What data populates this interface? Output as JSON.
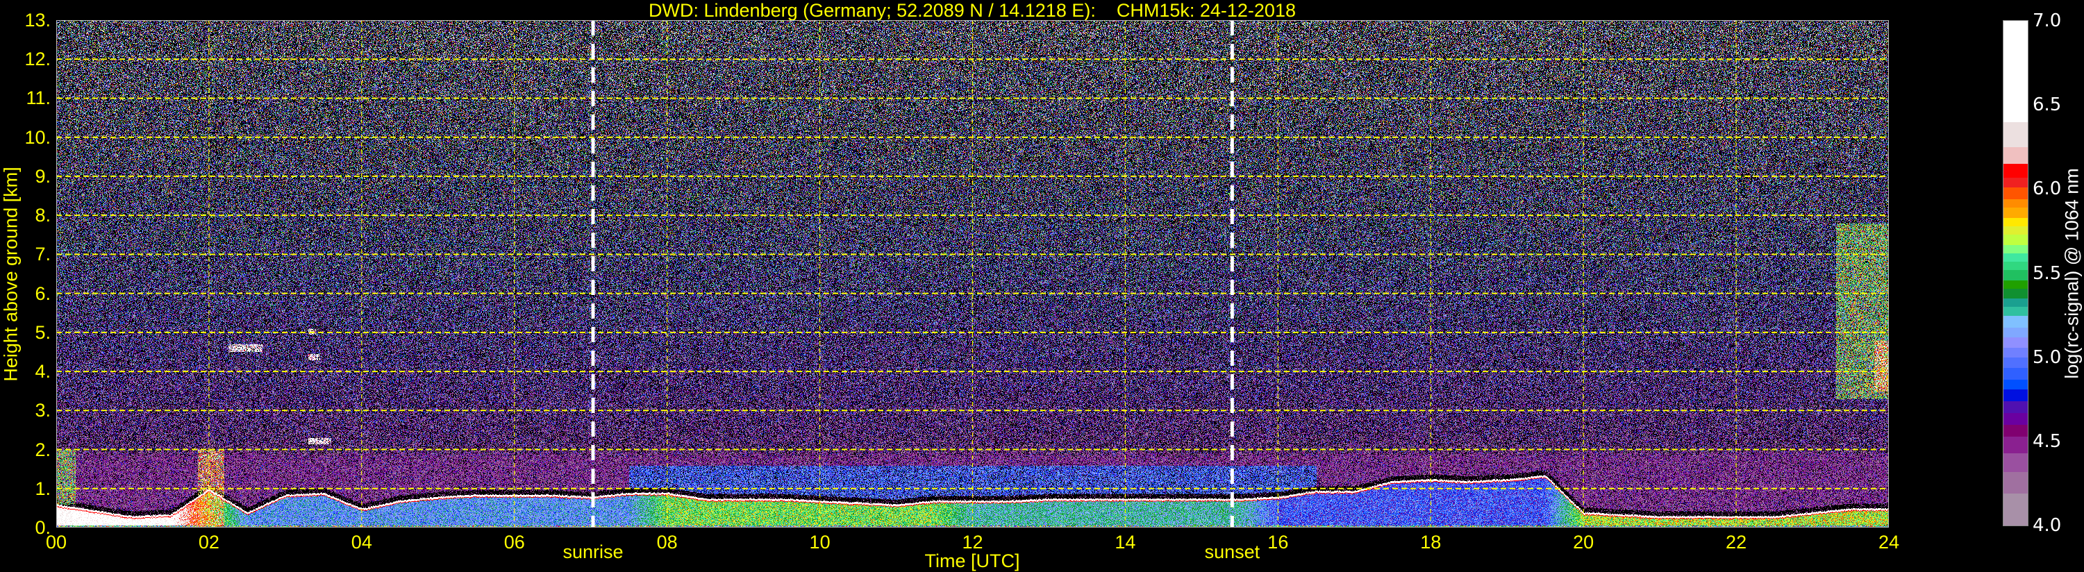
{
  "chart_data": {
    "type": "heatmap",
    "title": "DWD: Lindenberg (Germany; 52.2089 N / 14.1218 E):    CHM15k: 24-12-2018",
    "xlabel": "Time [UTC]",
    "ylabel": "Height above ground [km]",
    "xlim": [
      0,
      24
    ],
    "ylim": [
      0,
      13
    ],
    "xticks": [
      0,
      2,
      4,
      6,
      8,
      10,
      12,
      14,
      16,
      18,
      20,
      22,
      24
    ],
    "xtick_labels": [
      "00",
      "02",
      "04",
      "06",
      "08",
      "10",
      "12",
      "14",
      "16",
      "18",
      "20",
      "22",
      "24"
    ],
    "yticks": [
      0,
      1,
      2,
      3,
      4,
      5,
      6,
      7,
      8,
      9,
      10,
      11,
      12,
      13
    ],
    "ytick_labels": [
      "0.",
      "1.",
      "2.",
      "3.",
      "4.",
      "5.",
      "6.",
      "7.",
      "8.",
      "9.",
      "10.",
      "11.",
      "12.",
      "13."
    ],
    "grid": true,
    "events": [
      {
        "label": "sunrise",
        "time": 7.03
      },
      {
        "label": "sunset",
        "time": 15.4
      }
    ],
    "colorbar": {
      "label": "log(rc-signal) @ 1064 nm",
      "range": [
        4.0,
        7.0
      ],
      "ticks": [
        4.0,
        4.5,
        5.0,
        5.5,
        6.0,
        6.5,
        7.0
      ],
      "tick_labels": [
        "4.0",
        "4.5",
        "5.0",
        "5.5",
        "6.0",
        "6.5",
        "7.0"
      ],
      "boundaries": [
        4.0,
        4.19,
        4.32,
        4.43,
        4.53,
        4.6,
        4.67,
        4.74,
        4.81,
        4.87,
        4.94,
        5.0,
        5.06,
        5.12,
        5.18,
        5.25,
        5.3,
        5.35,
        5.41,
        5.46,
        5.52,
        5.57,
        5.62,
        5.67,
        5.73,
        5.78,
        5.83,
        5.89,
        5.94,
        6.01,
        6.07,
        6.15,
        6.25,
        6.4,
        7.0
      ],
      "colors": [
        "#a890a8",
        "#a070a0",
        "#9a50a0",
        "#8a2090",
        "#800070",
        "#6a00a0",
        "#5010b0",
        "#0010e0",
        "#0050ff",
        "#3060ff",
        "#5070ff",
        "#7080ff",
        "#9090ff",
        "#80a8ff",
        "#80c0ff",
        "#30c0a0",
        "#1aa090",
        "#109030",
        "#20a000",
        "#20c060",
        "#30d880",
        "#40e8a0",
        "#80ff80",
        "#c0ff40",
        "#e0f030",
        "#ffe800",
        "#ffaa00",
        "#ff8c00",
        "#ff5500",
        "#f02020",
        "#ff0000",
        "#f0c0c0",
        "#ece0e0",
        "#ffffff"
      ]
    },
    "series_time_h": [
      0,
      0.5,
      1,
      1.5,
      2,
      2.5,
      3,
      3.5,
      4,
      4.5,
      5,
      5.5,
      6,
      6.5,
      7,
      7.5,
      8,
      8.5,
      9,
      9.5,
      10,
      10.5,
      11,
      11.5,
      12,
      12.5,
      13,
      13.5,
      14,
      14.5,
      15,
      15.5,
      16,
      16.5,
      17,
      17.5,
      18,
      18.5,
      19,
      19.5,
      20,
      20.5,
      21,
      21.5,
      22,
      22.5,
      23,
      23.5,
      24
    ],
    "boundary_layer_top_km": [
      0.6,
      0.45,
      0.3,
      0.35,
      1.0,
      0.4,
      0.85,
      0.9,
      0.5,
      0.7,
      0.8,
      0.85,
      0.85,
      0.85,
      0.8,
      0.9,
      0.9,
      0.75,
      0.75,
      0.75,
      0.7,
      0.65,
      0.6,
      0.7,
      0.7,
      0.7,
      0.75,
      0.75,
      0.75,
      0.75,
      0.75,
      0.75,
      0.8,
      0.95,
      0.95,
      1.2,
      1.25,
      1.2,
      1.25,
      1.35,
      0.4,
      0.35,
      0.3,
      0.3,
      0.3,
      0.3,
      0.4,
      0.5,
      0.5
    ],
    "boundary_layer_signal": [
      6.6,
      6.6,
      6.6,
      6.6,
      5.8,
      5.1,
      5.1,
      5.1,
      5.1,
      5.1,
      5.1,
      5.1,
      5.1,
      5.1,
      5.1,
      5.1,
      5.6,
      5.6,
      5.6,
      5.6,
      5.6,
      5.6,
      5.6,
      5.6,
      5.3,
      5.3,
      5.3,
      5.3,
      5.3,
      5.3,
      5.3,
      5.3,
      4.9,
      4.9,
      4.9,
      4.9,
      4.9,
      4.9,
      4.9,
      4.9,
      5.7,
      5.7,
      5.7,
      5.7,
      5.7,
      5.7,
      5.7,
      5.7,
      5.7
    ],
    "aerosol_layer_top_km": 1.9,
    "features": [
      {
        "time": [
          0.0,
          0.25
        ],
        "height_km": [
          0.6,
          2.0
        ],
        "signal": 5.6
      },
      {
        "time": [
          1.85,
          2.2
        ],
        "height_km": [
          0.0,
          2.0
        ],
        "signal": 6.0
      },
      {
        "time": [
          2.25,
          2.7
        ],
        "height_km": [
          4.5,
          4.7
        ],
        "signal": 6.6
      },
      {
        "time": [
          3.3,
          3.45
        ],
        "height_km": [
          4.3,
          4.45
        ],
        "signal": 6.6
      },
      {
        "time": [
          3.3,
          3.4
        ],
        "height_km": [
          4.95,
          5.1
        ],
        "signal": 6.4
      },
      {
        "time": [
          3.3,
          3.6
        ],
        "height_km": [
          2.15,
          2.3
        ],
        "signal": 6.6
      },
      {
        "time": [
          23.3,
          24.0
        ],
        "height_km": [
          3.3,
          7.8
        ],
        "signal": 5.6
      },
      {
        "time": [
          23.8,
          24.0
        ],
        "height_km": [
          3.5,
          4.8
        ],
        "signal": 6.1
      }
    ],
    "grid_color": "#ffff00",
    "text_color": "#ffff00"
  }
}
